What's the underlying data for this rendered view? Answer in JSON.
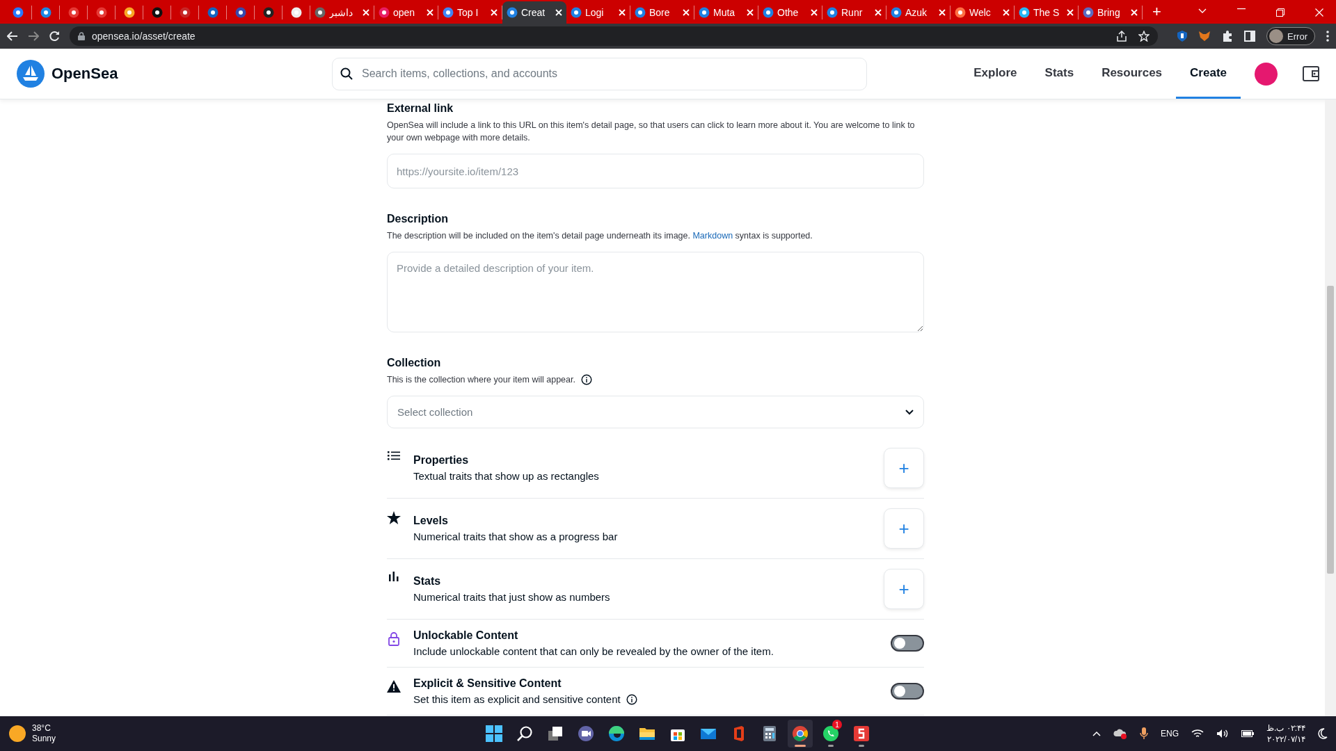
{
  "browser": {
    "tabs": [
      {
        "kind": "pinned",
        "selected": false
      },
      {
        "kind": "pinned",
        "selected": false
      },
      {
        "kind": "pinned",
        "selected": false
      },
      {
        "kind": "pinned",
        "selected": false
      },
      {
        "kind": "pinned",
        "selected": false
      },
      {
        "kind": "pinned",
        "selected": false
      },
      {
        "kind": "pinned",
        "selected": false
      },
      {
        "kind": "pinned",
        "selected": false
      },
      {
        "kind": "pinned",
        "selected": false
      },
      {
        "kind": "pinned",
        "selected": false
      },
      {
        "kind": "pinned",
        "selected": false
      },
      {
        "kind": "titled",
        "title": "داشبر",
        "selected": false
      },
      {
        "kind": "titled",
        "title": "open",
        "selected": false
      },
      {
        "kind": "titled",
        "title": "Top I",
        "selected": false
      },
      {
        "kind": "titled",
        "title": "Creat",
        "selected": true
      },
      {
        "kind": "titled",
        "title": "Logi",
        "selected": false
      },
      {
        "kind": "titled",
        "title": "Bore",
        "selected": false
      },
      {
        "kind": "titled",
        "title": "Muta",
        "selected": false
      },
      {
        "kind": "titled",
        "title": "Othe",
        "selected": false
      },
      {
        "kind": "titled",
        "title": "Runr",
        "selected": false
      },
      {
        "kind": "titled",
        "title": "Azuk",
        "selected": false
      },
      {
        "kind": "titled",
        "title": "Welc",
        "selected": false
      },
      {
        "kind": "titled",
        "title": "The S",
        "selected": false
      },
      {
        "kind": "titled",
        "title": "Bring",
        "selected": false
      }
    ],
    "new_tab": "+",
    "address": "opensea.io/asset/create",
    "profile": "Error"
  },
  "header": {
    "logo": "OpenSea",
    "search": {
      "placeholder": "Search items, collections, and accounts"
    },
    "nav": [
      {
        "label": "Explore",
        "selected": false
      },
      {
        "label": "Stats",
        "selected": false
      },
      {
        "label": "Resources",
        "selected": false
      },
      {
        "label": "Create",
        "selected": true
      }
    ]
  },
  "form": {
    "external_link": {
      "title": "External link",
      "help": "OpenSea will include a link to this URL on this item's detail page, so that users can click to learn more about it. You are welcome to link to your own webpage with more details.",
      "placeholder": "https://yoursite.io/item/123"
    },
    "description": {
      "title": "Description",
      "help_before": "The description will be included on the item's detail page underneath its image. ",
      "help_link": "Markdown",
      "help_after": " syntax is supported.",
      "placeholder": "Provide a detailed description of your item."
    },
    "collection": {
      "title": "Collection",
      "help": "This is the collection where your item will appear.",
      "placeholder": "Select collection"
    },
    "traits": [
      {
        "kind": "add",
        "title": "Properties",
        "subtitle": "Textual traits that show up as rectangles",
        "action": "+"
      },
      {
        "kind": "add",
        "title": "Levels",
        "subtitle": "Numerical traits that show as a progress bar",
        "action": "+"
      },
      {
        "kind": "add",
        "title": "Stats",
        "subtitle": "Numerical traits that just show as numbers",
        "action": "+"
      },
      {
        "kind": "toggle",
        "title": "Unlockable Content",
        "subtitle": "Include unlockable content that can only be revealed by the owner of the item.",
        "on": false
      },
      {
        "kind": "toggle",
        "title": "Explicit & Sensitive Content",
        "subtitle": "Set this item as explicit and sensitive content",
        "on": false,
        "info": true
      }
    ]
  },
  "taskbar": {
    "weather": {
      "temp": "38°C",
      "condition": "Sunny"
    },
    "apps": [
      {
        "selected": false,
        "running": false
      },
      {
        "selected": false,
        "running": false
      },
      {
        "selected": false,
        "running": false
      },
      {
        "selected": false,
        "running": false
      },
      {
        "selected": false,
        "running": false
      },
      {
        "selected": false,
        "running": false
      },
      {
        "selected": false,
        "running": false
      },
      {
        "selected": false,
        "running": false
      },
      {
        "selected": false,
        "running": false
      },
      {
        "selected": false,
        "running": false
      },
      {
        "selected": true,
        "running": true
      },
      {
        "selected": false,
        "running": true,
        "badge": "1"
      },
      {
        "selected": false,
        "running": true
      }
    ],
    "language": "ENG",
    "time": "۰۲:۴۴ ب.ظ",
    "date": "۲۰۲۲/۰۷/۱۴"
  }
}
